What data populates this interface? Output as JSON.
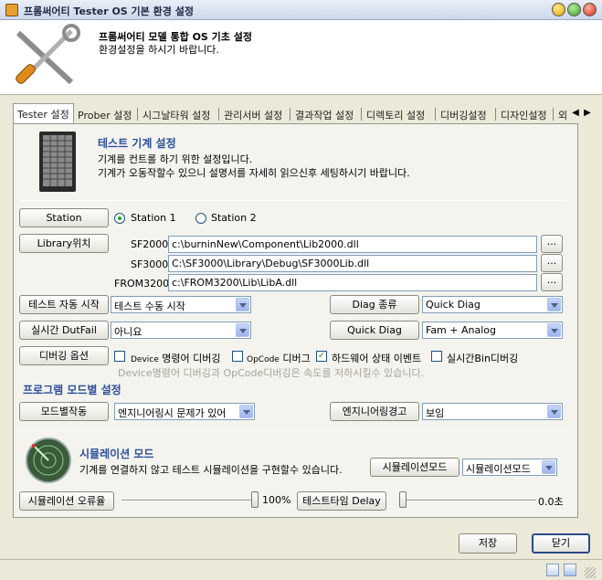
{
  "window": {
    "title": "프롬써어티 Tester OS 기본 환경 설정"
  },
  "header": {
    "title": "프롬써어티 모델 통합 OS 기초 설정",
    "subtitle": "환경설정을 하시기 바랍니다."
  },
  "tabs": [
    "Tester 설정",
    "Prober 설정",
    "시그날타워 설정",
    "관리서버 설정",
    "결과작업 설정",
    "디렉토리 설정",
    "디버깅설정",
    "디자인설정",
    "외"
  ],
  "machine": {
    "title": "테스트 기계 설정",
    "desc1": "기계를 컨트롤 하기 위한 설정입니다.",
    "desc2": "기계가 오동작할수 있으니 설명서를 자세히 읽으신후 세팅하시기 바랍니다."
  },
  "station": {
    "button": "Station",
    "opt1": "Station 1",
    "opt2": "Station 2",
    "selected": "Station 1"
  },
  "library": {
    "button": "Library위치",
    "rows": [
      {
        "label": "SF2000",
        "path": "c:\\burninNew\\Component\\Lib2000.dll"
      },
      {
        "label": "SF3000",
        "path": "C:\\SF3000\\Library\\Debug\\SF3000Lib.dll"
      },
      {
        "label": "FROM3200",
        "path": "c:\\FROM3200\\Lib\\LibA.dll"
      }
    ],
    "browse": "..."
  },
  "autostart": {
    "button": "테스트 자동 시작",
    "value": "테스트 수동 시작"
  },
  "diagtype": {
    "button": "Diag 종류",
    "value": "Quick Diag"
  },
  "dutfail": {
    "button": "실시간 DutFail",
    "value": "아니요"
  },
  "quickdiag": {
    "button": "Quick Diag",
    "value": "Fam + Analog"
  },
  "debug": {
    "button": "디버깅 옵션",
    "options": [
      {
        "prefix": "Device",
        "label": "명령어 디버깅",
        "checked": false
      },
      {
        "prefix": "OpCode",
        "label": "디버그",
        "checked": false
      },
      {
        "prefix": "",
        "label": "하드웨어 상태 이벤트",
        "checked": true
      },
      {
        "prefix": "",
        "label": "실시간Bin디버깅",
        "checked": false
      }
    ],
    "note": "Device명령어 디버깅과 OpCode디버깅은 속도를 저하시킬수 있습니다."
  },
  "modes": {
    "title": "프로그램 모드별 설정",
    "modebutton": "모드별작동",
    "modevalue": "엔지니어링시 문제가 있어",
    "engbutton": "엔지니어링경고",
    "engvalue": "보임"
  },
  "sim": {
    "title": "시뮬레이션 모드",
    "desc": "기계를 연결하지 않고 테스트 시뮬레이션을 구현할수 있습니다.",
    "modebutton": "시뮬레이션모드",
    "modevalue": "시뮬레이션모드",
    "errbutton": "시뮬레이션 오류율",
    "errvalue": "100%",
    "errfraction": 1.0,
    "delaybutton": "테스트타임 Delay",
    "delayvalue": "0.0초",
    "delayfraction": 0.0
  },
  "footer": {
    "save": "저장",
    "close": "닫기"
  }
}
